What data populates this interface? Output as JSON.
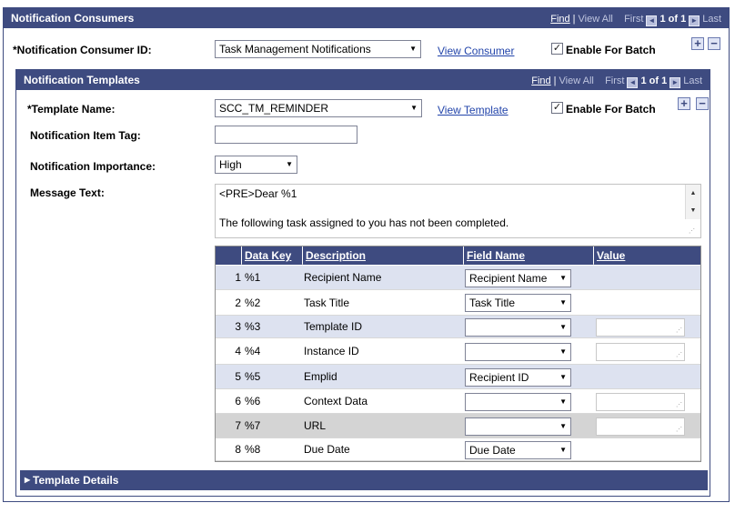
{
  "consumers_section": {
    "title": "Notification Consumers",
    "nav": {
      "find": "Find",
      "sep": "|",
      "view_all": "View All",
      "first": "First",
      "range": "1 of 1",
      "last": "Last"
    }
  },
  "consumer_id": {
    "label": "*Notification Consumer ID:",
    "value": "Task Management Notifications",
    "view_link": "View Consumer",
    "enable_batch_label": "Enable For Batch",
    "enable_batch_checked": true
  },
  "templates_section": {
    "title": "Notification Templates",
    "nav": {
      "find": "Find",
      "sep": "|",
      "view_all": "View All",
      "first": "First",
      "range": "1 of 1",
      "last": "Last"
    }
  },
  "template": {
    "name_label": "*Template Name:",
    "name_value": "SCC_TM_REMINDER",
    "view_link": "View Template",
    "enable_batch_label": "Enable For Batch",
    "enable_batch_checked": true,
    "item_tag_label": "Notification Item Tag:",
    "item_tag_value": "",
    "importance_label": "Notification Importance:",
    "importance_value": "High",
    "message_label": "Message Text:",
    "message_text": "<PRE>Dear %1\n\nThe following task assigned to you has not been completed."
  },
  "grid": {
    "headers": {
      "data_key": "Data Key",
      "description": "Description",
      "field_name": "Field Name",
      "value": "Value"
    },
    "rows": [
      {
        "num": "1",
        "key": "%1",
        "desc": "Recipient Name",
        "field": "Recipient Name",
        "value_editable": false
      },
      {
        "num": "2",
        "key": "%2",
        "desc": "Task Title",
        "field": "Task Title",
        "value_editable": false
      },
      {
        "num": "3",
        "key": "%3",
        "desc": "Template ID",
        "field": "",
        "value_editable": true
      },
      {
        "num": "4",
        "key": "%4",
        "desc": "Instance ID",
        "field": "",
        "value_editable": true
      },
      {
        "num": "5",
        "key": "%5",
        "desc": "Emplid",
        "field": "Recipient ID",
        "value_editable": false
      },
      {
        "num": "6",
        "key": "%6",
        "desc": "Context Data",
        "field": "",
        "value_editable": true
      },
      {
        "num": "7",
        "key": "%7",
        "desc": "URL",
        "field": "",
        "value_editable": true
      },
      {
        "num": "8",
        "key": "%8",
        "desc": "Due Date",
        "field": "Due Date",
        "value_editable": false
      }
    ]
  },
  "template_details": {
    "label": "Template Details"
  },
  "icons": {
    "add": "+",
    "remove": "−",
    "check": "✓",
    "dropdown": "▼",
    "prev": "◄",
    "next": "►",
    "expand": "▶"
  },
  "colors": {
    "header_bg": "#3e4b80",
    "row_alt": "#dde2f0",
    "row_hover": "#d4d4d4"
  }
}
